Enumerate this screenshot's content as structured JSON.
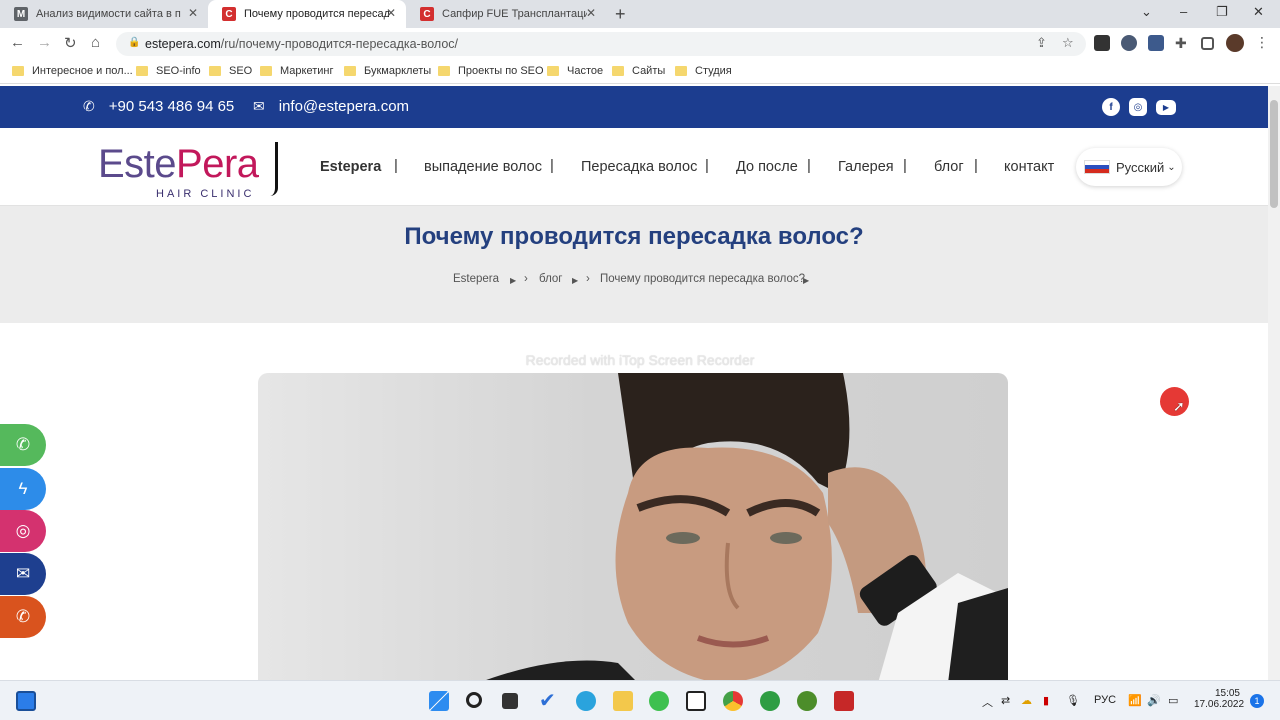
{
  "tabs": [
    {
      "title": "Анализ видимости сайта в пои",
      "favicon": "M",
      "favicon_color": "#5f6368"
    },
    {
      "title": "Почему проводится пересадка",
      "favicon": "C",
      "favicon_color": "#d32f2f"
    },
    {
      "title": "Сапфир FUE Трансплантация во",
      "favicon": "C",
      "favicon_color": "#d32f2f"
    }
  ],
  "window": {
    "new_tab": "+",
    "chevron": "⌄",
    "minimize": "–",
    "restore": "❐",
    "close": "✕"
  },
  "address": {
    "domain": "estepera.com",
    "path": "/ru/почему-проводится-пересадка-волос/"
  },
  "bookmarks": [
    "Интересное и пол...",
    "SEO-info",
    "SEO",
    "Маркетинг",
    "Букмарклеты",
    "Проекты по SEO",
    "Частое",
    "Сайты",
    "Студия"
  ],
  "topbar": {
    "phone": "+90 543 486 94 65",
    "email": "info@estepera.com",
    "color": "#1c3d8f"
  },
  "logo": {
    "part1": "Este",
    "part2": "Pera",
    "tagline": "HAIR CLINIC"
  },
  "menu": [
    "Estepera",
    "выпадение волос",
    "Пересадка волос",
    "До после",
    "Галерея",
    "блог",
    "контакт"
  ],
  "language": "Русский",
  "page": {
    "title": "Почему проводится пересадка волос?",
    "breadcrumb": [
      "Estepera",
      "блог",
      "Почему проводится пересадка волос?"
    ]
  },
  "watermark": "Recorded with iTop Screen Recorder",
  "taskbar": {
    "lang": "РУС",
    "time": "15:05",
    "date": "17.06.2022",
    "notifications": "1"
  }
}
